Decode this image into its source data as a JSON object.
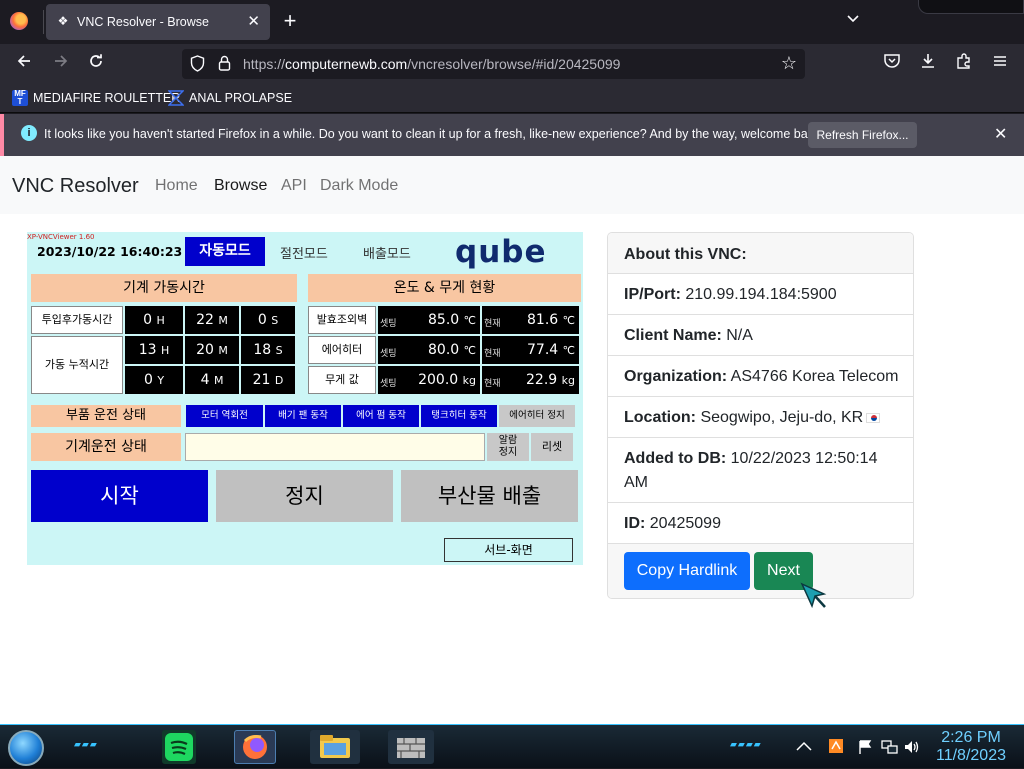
{
  "browser": {
    "tab_title": "VNC Resolver - Browse",
    "new_tab": "+",
    "tab_list": "⌄",
    "url_prefix": "https://",
    "url_host": "computernewb.com",
    "url_path": "/vncresolver/browse/#id/20425099",
    "bookmarks": [
      {
        "label": "MEDIAFIRE ROULETTER",
        "icon_text": "MF",
        "icon_color": "#1e4fd6"
      },
      {
        "label": "ANAL PROLAPSE",
        "icon_color": "#2a5bd7"
      }
    ],
    "notification": {
      "message": "It looks like you haven't started Firefox in a while. Do you want to clean it up for a fresh, like-new experience? And by the way, welcome back!",
      "button": "Refresh Firefox...",
      "accent": "#ff8aa6"
    }
  },
  "site": {
    "brand": "VNC Resolver",
    "nav": [
      "Home",
      "Browse",
      "API",
      "Dark Mode"
    ],
    "active_nav": "Browse"
  },
  "vnc_screen": {
    "viewer_version": "XP-VNCViewer 1.60",
    "datetime": "2023/10/22  16:40:23",
    "mode_active": "자동모드",
    "mode_power_save": "절전모드",
    "mode_discharge": "배출모드",
    "logo": "qube",
    "section_runtime": "기계 가동시간",
    "section_temp_weight": "온도 & 무게 현황",
    "row_since_input": "투입후가동시간",
    "row_cumulative": "가동 누적시간",
    "runtime_1": {
      "h": "0",
      "h_unit": "H",
      "m": "22",
      "m_unit": "M",
      "s": "0",
      "s_unit": "S"
    },
    "runtime_2": {
      "h": "13",
      "h_unit": "H",
      "m": "20",
      "m_unit": "M",
      "s": "18",
      "s_unit": "S"
    },
    "runtime_3": {
      "y": "0",
      "y_unit": "Y",
      "m": "4",
      "m_unit": "M",
      "d": "21",
      "d_unit": "D"
    },
    "temp_rows": [
      {
        "label": "발효조외벽",
        "set_label": "셋팅",
        "set": "85.0",
        "set_unit": "℃",
        "cur_label": "현재",
        "cur": "81.6",
        "cur_unit": "℃"
      },
      {
        "label": "에어히터",
        "set_label": "셋팅",
        "set": "80.0",
        "set_unit": "℃",
        "cur_label": "현재",
        "cur": "77.4",
        "cur_unit": "℃"
      },
      {
        "label": "무게 값",
        "set_label": "셋팅",
        "set": "200.0",
        "set_unit": "kg",
        "cur_label": "현재",
        "cur": "22.9",
        "cur_unit": "kg"
      }
    ],
    "parts_status_label": "부품 운전 상태",
    "parts": [
      "모터 역회전",
      "배기 팬 동작",
      "에어 펌 동작",
      "탱크히터 동작",
      "에어히터 정지"
    ],
    "machine_status_label": "기계운전 상태",
    "alarm_stop": "알람\n정지",
    "reset": "리셋",
    "btn_start": "시작",
    "btn_stop": "정지",
    "btn_byproduct": "부산물 배출",
    "btn_sub_screen": "서브-화면"
  },
  "about": {
    "header": "About this VNC:",
    "ip_label": "IP/Port:",
    "ip_value": "210.99.194.184:5900",
    "client_label": "Client Name:",
    "client_value": "N/A",
    "org_label": "Organization:",
    "org_value": "AS4766 Korea Telecom",
    "loc_label": "Location:",
    "loc_value": "Seogwipo, Jeju-do, KR",
    "added_label": "Added to DB:",
    "added_value": "10/22/2023 12:50:14 AM",
    "id_label": "ID:",
    "id_value": "20425099",
    "copy_button": "Copy Hardlink",
    "next_button": "Next",
    "copy_color": "#0d6efd",
    "next_color": "#198754"
  },
  "taskbar": {
    "time": "2:26 PM",
    "date": "11/8/2023",
    "apps": [
      "spotify-icon",
      "firefox-icon",
      "file-explorer-icon",
      "firewall-icon"
    ]
  }
}
